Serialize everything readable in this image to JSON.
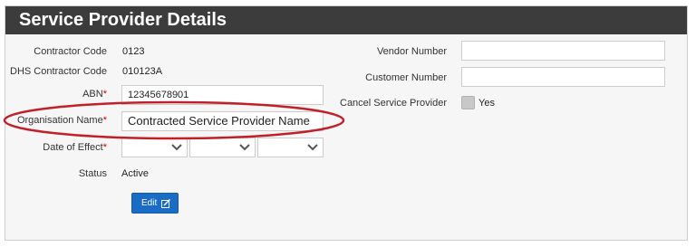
{
  "header": {
    "title": "Service Provider Details"
  },
  "fields": {
    "contractor_code": {
      "label": "Contractor Code",
      "value": "0123"
    },
    "dhs_contractor_code": {
      "label": "DHS Contractor Code",
      "value": "010123A"
    },
    "abn": {
      "label": "ABN",
      "required": "*",
      "value": "12345678901"
    },
    "organisation_name": {
      "label": "Organisation Name",
      "required": "*",
      "value": "Contracted Service Provider Name"
    },
    "date_of_effect": {
      "label": "Date of Effect",
      "required": "*",
      "day": "",
      "month": "",
      "year": ""
    },
    "status": {
      "label": "Status",
      "value": "Active"
    },
    "vendor_number": {
      "label": "Vendor Number",
      "value": ""
    },
    "customer_number": {
      "label": "Customer Number",
      "value": ""
    },
    "cancel_service_provider": {
      "label": "Cancel Service Provider",
      "option": "Yes",
      "checked": false
    }
  },
  "buttons": {
    "edit_label": "Edit"
  },
  "icons": {
    "chevron": "chevron-down-icon",
    "edit": "edit-icon"
  },
  "colors": {
    "header_bg": "#3c3c3c",
    "button": "#1b6cc4",
    "required": "#cc0000",
    "annotation": "#c0202a"
  }
}
